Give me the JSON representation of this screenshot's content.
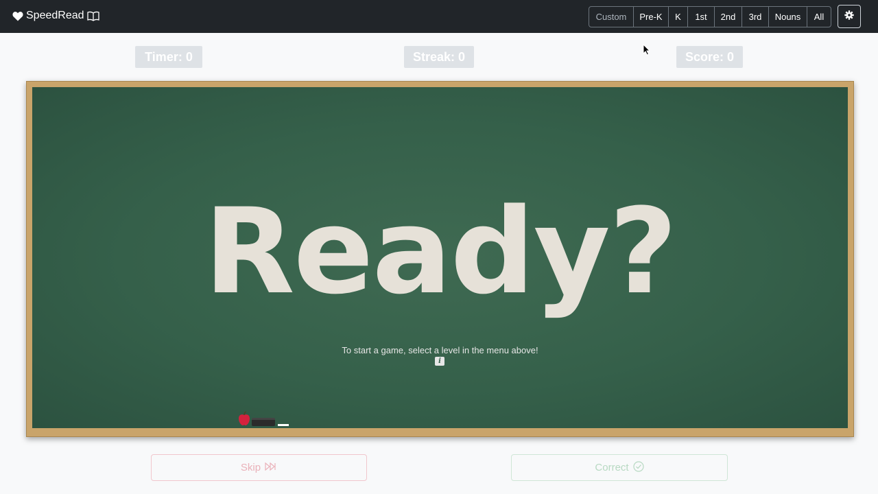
{
  "navbar": {
    "brand": "SpeedRead",
    "brand_icon_left": "heart-icon",
    "brand_icon_right": "book-icon",
    "levels": [
      "Custom",
      "Pre-K",
      "K",
      "1st",
      "2nd",
      "3rd",
      "Nouns",
      "All"
    ],
    "settings_icon": "gear-icon"
  },
  "stats": {
    "timer": "Timer: 0",
    "streak": "Streak: 0",
    "score": "Score: 0"
  },
  "board": {
    "word": "Ready?",
    "hint": "To start a game, select a level in the menu above!",
    "info_label": "i"
  },
  "actions": {
    "skip": "Skip",
    "skip_icon": "fast-forward-icon",
    "correct": "Correct",
    "correct_icon": "check-circle-icon"
  },
  "colors": {
    "navbar": "#212529",
    "board": "#35604a",
    "frame": "#c9a46a",
    "chalk_text": "#e6e1d8",
    "skip": "#eab1b9",
    "correct": "#b7d9c2"
  }
}
